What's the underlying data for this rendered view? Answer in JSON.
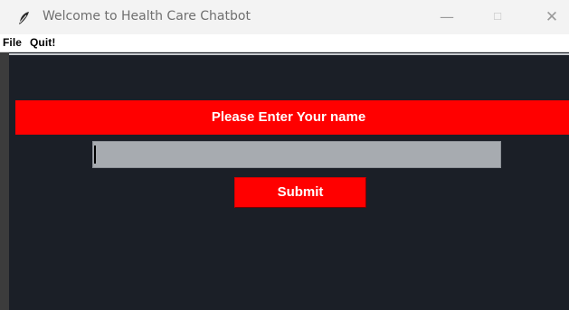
{
  "window": {
    "title": "Welcome to Health Care Chatbot",
    "controls": {
      "minimize": "—",
      "maximize": "☐",
      "close": "✕"
    }
  },
  "menubar": {
    "items": [
      {
        "label": "File"
      },
      {
        "label": "Quit!"
      }
    ]
  },
  "main": {
    "prompt": "Please Enter Your name",
    "name_input_value": "",
    "submit_label": "Submit"
  },
  "icons": {
    "app": "feather-icon",
    "minimize": "minimize-icon",
    "maximize": "maximize-icon",
    "close": "close-icon"
  },
  "colors": {
    "background": "#1b1f27",
    "accent": "#ff0000",
    "input": "#a7abb0",
    "text_on_accent": "#ffffff"
  }
}
